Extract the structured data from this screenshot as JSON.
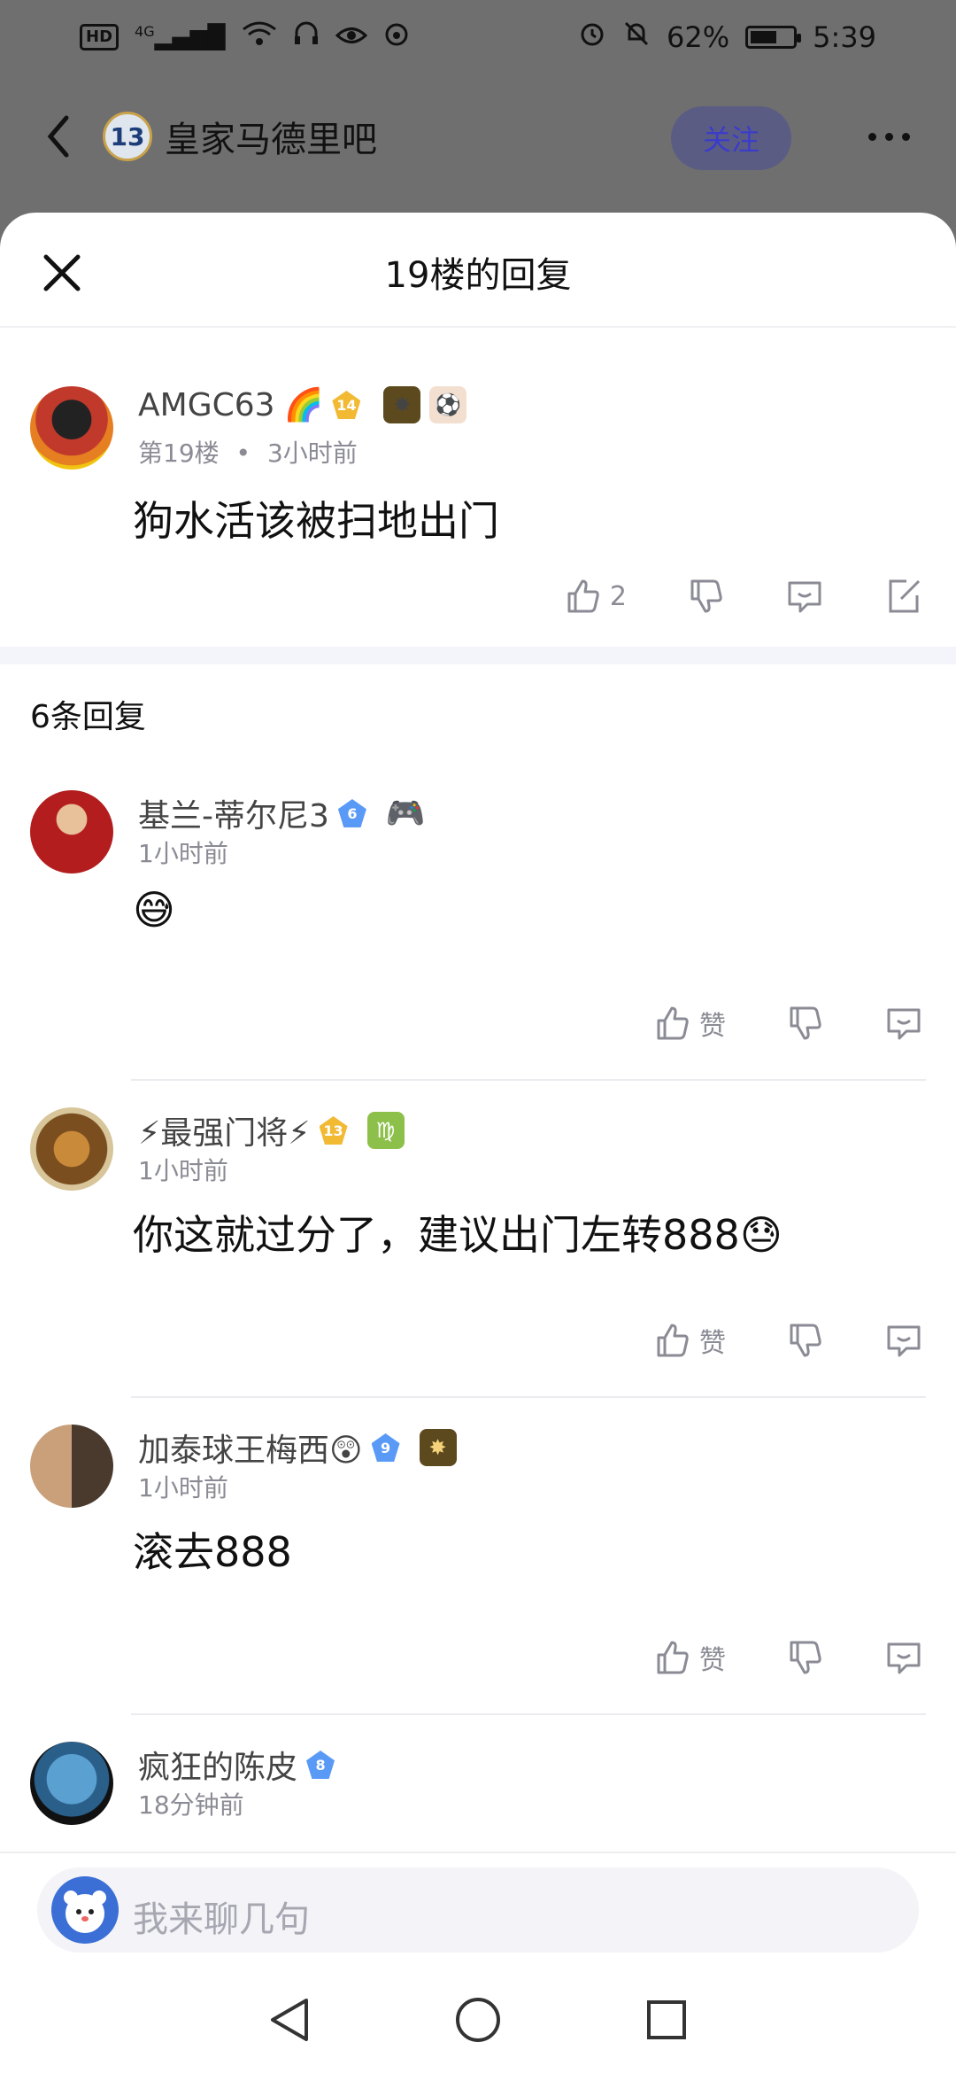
{
  "status": {
    "hd": "HD",
    "network": "4G",
    "battery_percent": "62%",
    "battery_level": 0.62,
    "time": "5:39"
  },
  "header": {
    "forum_badge": "13",
    "forum_name": "皇家马德里吧",
    "follow_label": "关注"
  },
  "sheet": {
    "title": "19楼的回复"
  },
  "main_post": {
    "username": "AMGC63",
    "level": "14",
    "floor": "第19楼",
    "dot": "•",
    "time": "3小时前",
    "content": "狗水活该被扫地出门",
    "like_count": "2"
  },
  "reply_count_label": "6条回复",
  "replies": [
    {
      "username": "基兰-蒂尔尼3",
      "level": "6",
      "time": "1小时前",
      "content": "😅",
      "like_label": "赞"
    },
    {
      "username": "⚡最强门将⚡",
      "level": "13",
      "time": "1小时前",
      "content": "你这就过分了，建议出门左转888",
      "like_label": "赞"
    },
    {
      "username": "加泰球王梅西😲",
      "level": "9",
      "time": "1小时前",
      "content": "滚去888",
      "like_label": "赞"
    },
    {
      "username": "疯狂的陈皮",
      "level": "8",
      "time": "18分钟前"
    }
  ],
  "input": {
    "placeholder": "我来聊几句"
  },
  "colors": {
    "accent": "#3b3cc8",
    "gold_badge": "#f2b933",
    "blue_badge": "#5a9af7"
  }
}
